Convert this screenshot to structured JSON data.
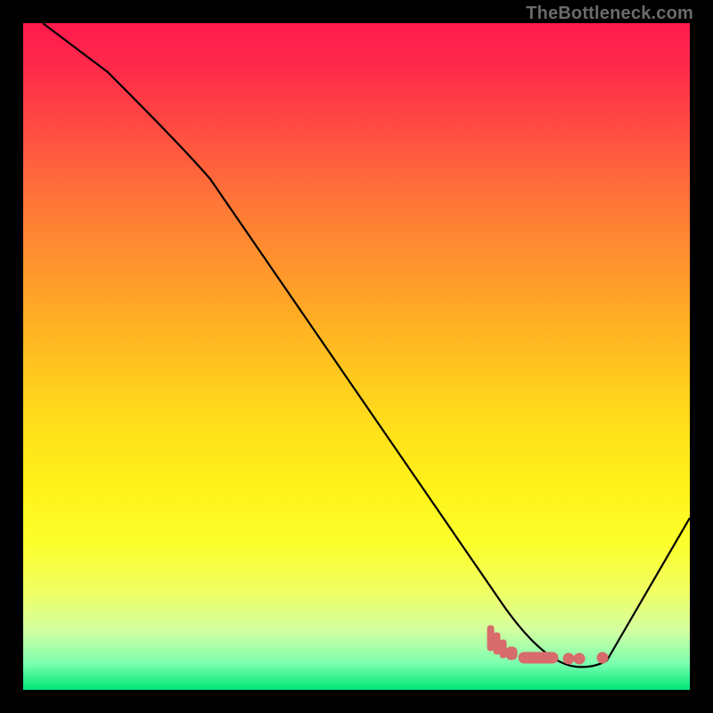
{
  "watermark": "TheBottleneck.com",
  "chart_data": {
    "type": "line",
    "title": "",
    "xlabel": "",
    "ylabel": "",
    "xlim": [
      0,
      100
    ],
    "ylim": [
      0,
      100
    ],
    "series": [
      {
        "name": "bottleneck-curve",
        "x": [
          3,
          10,
          18,
          25,
          34,
          43,
          52,
          60,
          66,
          70,
          74,
          78,
          82,
          86,
          90,
          94,
          98,
          100
        ],
        "y": [
          100,
          93,
          85,
          78,
          67,
          55,
          44,
          32,
          23,
          16,
          10,
          5,
          2,
          1,
          1,
          6,
          18,
          26
        ]
      }
    ],
    "markers": {
      "name": "optimal-range",
      "points": [
        {
          "x": 70,
          "y": 6.5
        },
        {
          "x": 71,
          "y": 5.5
        },
        {
          "x": 72,
          "y": 4.5
        },
        {
          "x": 73,
          "y": 3.8
        },
        {
          "x": 74,
          "y": 3.2
        },
        {
          "x": 76,
          "y": 2.8
        },
        {
          "x": 78,
          "y": 2.6
        },
        {
          "x": 80,
          "y": 2.6
        },
        {
          "x": 83,
          "y": 2.6
        },
        {
          "x": 87,
          "y": 2.6
        }
      ],
      "color": "#d86b6b"
    }
  }
}
